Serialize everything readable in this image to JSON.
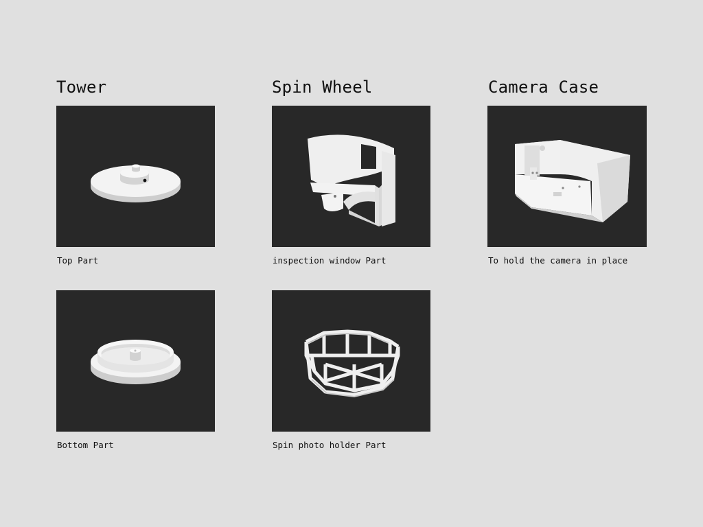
{
  "columns": [
    {
      "title": "Tower",
      "parts": [
        {
          "caption": "Top Part",
          "model": "disc-top-model"
        },
        {
          "caption": "Bottom Part",
          "model": "disc-bottom-model"
        }
      ]
    },
    {
      "title": "Spin Wheel",
      "parts": [
        {
          "caption": "inspection window Part",
          "model": "curved-wall-model"
        },
        {
          "caption": "Spin photo holder Part",
          "model": "octagon-frame-model"
        }
      ]
    },
    {
      "title": "Camera Case",
      "parts": [
        {
          "caption": "To hold the camera in place",
          "model": "camera-box-model"
        }
      ]
    }
  ],
  "colors": {
    "page_background": "#e0e0e0",
    "viewport_background": "#282828",
    "model_light": "#f2f2f2",
    "model_shade": "#cfcfcf"
  }
}
